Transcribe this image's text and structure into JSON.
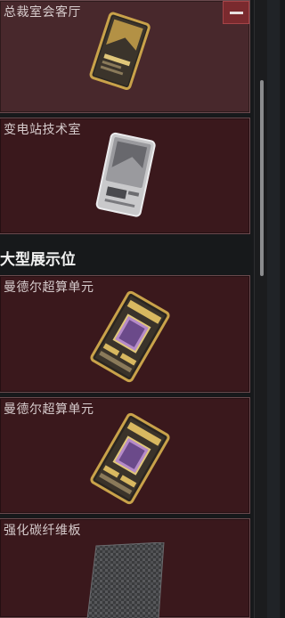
{
  "collapse_icon": "minus-icon",
  "section": {
    "title": "大型展示位"
  },
  "cards": [
    {
      "title": "总裁室会客厅",
      "icon": "gold-keycard-icon"
    },
    {
      "title": "变电站技术室",
      "icon": "white-keycard-icon"
    },
    {
      "title": "曼德尔超算单元",
      "icon": "circuit-board-icon"
    },
    {
      "title": "曼德尔超算单元",
      "icon": "circuit-board-icon"
    },
    {
      "title": "强化碳纤维板",
      "icon": "carbon-fiber-plate-icon"
    }
  ],
  "colors": {
    "card_bg": "#3a181c",
    "card_border": "#6a4a4e",
    "collapse_button": "#7a2a2e",
    "gold": "#c9a24a"
  }
}
